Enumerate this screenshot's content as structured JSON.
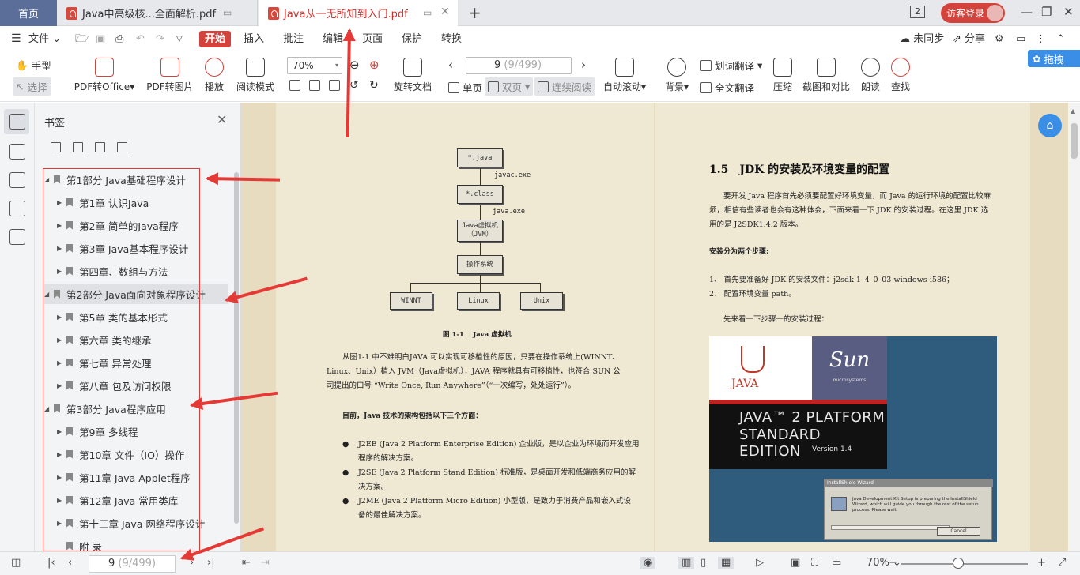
{
  "tabs": {
    "home": "首页",
    "tab1": "Java中高级核...全面解析.pdf",
    "tab2": "Java从一无所知到入门.pdf"
  },
  "titlebar": {
    "window_count": "2",
    "login": "访客登录"
  },
  "menu": {
    "file": "文件",
    "items": [
      "开始",
      "插入",
      "批注",
      "编辑",
      "页面",
      "保护",
      "转换"
    ],
    "sync": "未同步",
    "share": "分享"
  },
  "toolbar": {
    "hand": "手型",
    "select": "选择",
    "pdf_office": "PDF转Office",
    "pdf_image": "PDF转图片",
    "play": "播放",
    "read_mode": "阅读模式",
    "zoom": "70%",
    "rotate": "旋转文档",
    "page_current": "9",
    "page_total": "(9/499)",
    "single": "单页",
    "double": "双页",
    "continuous": "连续阅读",
    "auto_scroll": "自动滚动",
    "background": "背景",
    "word_translate": "划词翻译",
    "full_translate": "全文翻译",
    "compress": "压缩",
    "screenshot_compare": "截图和对比",
    "read_aloud": "朗读",
    "find": "查找",
    "side_button": "拖拽"
  },
  "bookmarks": {
    "title": "书签",
    "items": [
      {
        "label": "第1部分  Java基础程序设计",
        "level": 0
      },
      {
        "label": "第1章  认识Java",
        "level": 1
      },
      {
        "label": "第2章  简单的Java程序",
        "level": 1
      },
      {
        "label": "第3章  Java基本程序设计",
        "level": 1
      },
      {
        "label": "第四章、数组与方法",
        "level": 1
      },
      {
        "label": "第2部分  Java面向对象程序设计",
        "level": 0
      },
      {
        "label": "第5章  类的基本形式",
        "level": 1
      },
      {
        "label": "第六章  类的继承",
        "level": 1
      },
      {
        "label": "第七章  异常处理",
        "level": 1
      },
      {
        "label": "第八章 包及访问权限",
        "level": 1
      },
      {
        "label": "第3部分  Java程序应用",
        "level": 0
      },
      {
        "label": "第9章  多线程",
        "level": 1
      },
      {
        "label": "第10章 文件（IO）操作",
        "level": 1
      },
      {
        "label": "第11章 Java Applet程序",
        "level": 1
      },
      {
        "label": "第12章 Java 常用类库",
        "level": 1
      },
      {
        "label": "第十三章 Java 网络程序设计",
        "level": 1
      },
      {
        "label": "附 录",
        "level": 1
      }
    ]
  },
  "left_page": {
    "diagram": {
      "java": "*.java",
      "javac": "javac.exe",
      "class": "*.class",
      "javaexe": "java.exe",
      "jvm1": "Java虚拟机",
      "jvm2": "（JVM）",
      "os": "操作系统",
      "winnt": "WINNT",
      "linux": "Linux",
      "unix": "Unix"
    },
    "caption": "图 1-1　 Java 虚拟机",
    "para1_l1": "从图1-1 中不难明白JAVA 可以实现可移植性的原因，只要在操作系统上(WINNT、",
    "para1_l2": "Linux、Unix）植入 JVM（Java虚拟机），JAVA 程序就具有可移植性，也符合 SUN 公",
    "para1_l3": "司提出的口号 “Write Once, Run Anywhere”（“一次编写，处处运行”）。",
    "heading": "目前，Java 技术的架构包括以下三个方面：",
    "b1_l1": "J2EE (Java 2 Platform Enterprise Edition)  企业版，是以企业为环境而开发应用",
    "b1_l2": "程序的解决方案。",
    "b2_l1": "J2SE (Java 2 Platform Stand Edition)  标准版，是桌面开发和低端商务应用的解",
    "b2_l2": "决方案。",
    "b3_l1": "J2ME (Java 2 Platform Micro Edition)  小型版，是致力于消费产品和嵌入式设",
    "b3_l2": "备的最佳解决方案。",
    "bullet": "●"
  },
  "right_page": {
    "heading": "1.5　JDK 的安装及环境变量的配置",
    "p1_l1": "要开发 Java 程序首先必须要配置好环境变量，而 Java 的运行环境的配置比较麻",
    "p1_l2": "烦，相信有些读者也会有这种体会，下面来看一下 JDK 的安装过程。在这里 JDK 选",
    "p1_l3": "用的是 J2SDK1.4.2 版本。",
    "sub": "安装分为两个步骤:",
    "s1": "1、  首先要准备好 JDK 的安装文件：j2sdk-1_4_0_03-windows-i586；",
    "s2": "2、  配置环境变量 path。",
    "p2": "先来看一下步骤一的安装过程：",
    "img": {
      "java": "JAVA",
      "sun": "Sun",
      "sun_sub": "microsystems",
      "line1": "JAVA™ 2 PLATFORM",
      "line2": "STANDARD EDITION",
      "version": "Version 1.4",
      "wizard_title": "InstallShield Wizard",
      "wizard_text": "Java Development Kit Setup is preparing the InstallShield Wizard, which will guide you through the rest of the setup process. Please wait.",
      "cancel": "Cancel"
    }
  },
  "status": {
    "page_current": "9",
    "page_total": "(9/499)",
    "zoom": "70%"
  },
  "colors": {
    "accent": "#d4433b",
    "annotation": "#e53935",
    "page_bg": "#efe8d3"
  }
}
